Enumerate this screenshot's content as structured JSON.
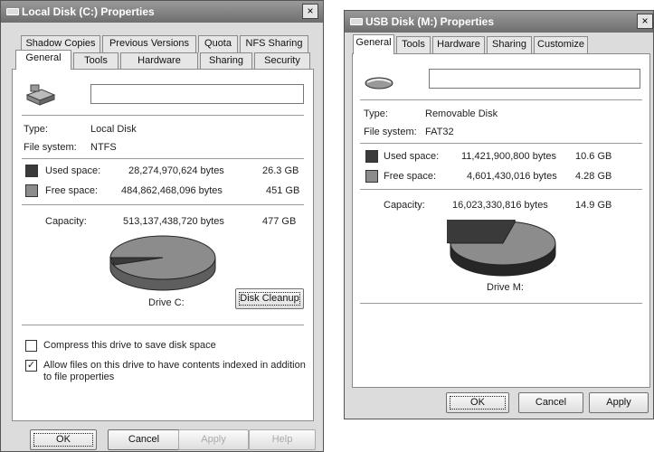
{
  "colors": {
    "used": "#3a3a3a",
    "free": "#8c8c8c",
    "title": "#7a7a7a"
  },
  "left": {
    "title": "Local Disk (C:) Properties",
    "close": "×",
    "tabs_row1": [
      "Shadow Copies",
      "Previous Versions",
      "Quota",
      "NFS Sharing"
    ],
    "tabs_row2": [
      "General",
      "Tools",
      "Hardware",
      "Sharing",
      "Security"
    ],
    "name_value": "",
    "type_label": "Type:",
    "type_value": "Local Disk",
    "fs_label": "File system:",
    "fs_value": "NTFS",
    "used_label": "Used space:",
    "used_bytes": "28,274,970,624 bytes",
    "used_gb": "26.3 GB",
    "free_label": "Free space:",
    "free_bytes": "484,862,468,096 bytes",
    "free_gb": "451 GB",
    "cap_label": "Capacity:",
    "cap_bytes": "513,137,438,720 bytes",
    "cap_gb": "477 GB",
    "used_fraction": 0.055,
    "drive_label": "Drive C:",
    "cleanup_button": "Disk Cleanup",
    "compress_label": "Compress this drive to save disk space",
    "compress_checked": false,
    "index_label": "Allow files on this drive to have contents indexed in addition to file properties",
    "index_checked": true,
    "check_mark": "✓",
    "buttons": {
      "ok": "OK",
      "cancel": "Cancel",
      "apply": "Apply",
      "help": "Help"
    }
  },
  "right": {
    "title": "USB Disk (M:) Properties",
    "close": "×",
    "tabs": [
      "General",
      "Tools",
      "Hardware",
      "Sharing",
      "Customize"
    ],
    "name_value": "",
    "type_label": "Type:",
    "type_value": "Removable Disk",
    "fs_label": "File system:",
    "fs_value": "FAT32",
    "used_label": "Used space:",
    "used_bytes": "11,421,900,800 bytes",
    "used_gb": "10.6 GB",
    "free_label": "Free space:",
    "free_bytes": "4,601,430,016 bytes",
    "free_gb": "4.28 GB",
    "cap_label": "Capacity:",
    "cap_bytes": "16,023,330,816 bytes",
    "cap_gb": "14.9 GB",
    "used_fraction": 0.713,
    "drive_label": "Drive M:",
    "buttons": {
      "ok": "OK",
      "cancel": "Cancel",
      "apply": "Apply"
    }
  }
}
